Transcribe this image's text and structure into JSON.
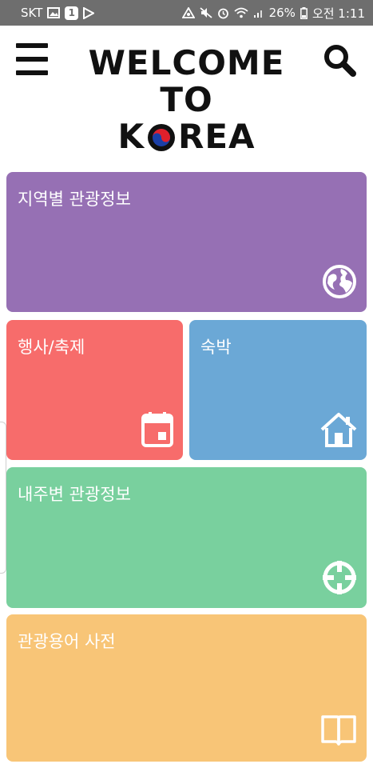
{
  "status_bar": {
    "carrier": "SKT",
    "badge": "1",
    "battery": "26%",
    "time": "오전 1:11"
  },
  "header": {
    "title_line1": "WELCOME",
    "title_line2": "TO",
    "title_k": "K",
    "title_rea": "REA"
  },
  "tiles": [
    {
      "label": "지역별 관광정보",
      "color": "#9670b4",
      "icon": "globe-icon"
    },
    {
      "label": "행사/축제",
      "color": "#f76c6b",
      "icon": "calendar-icon"
    },
    {
      "label": "숙박",
      "color": "#6ba8d6",
      "icon": "house-icon"
    },
    {
      "label": "내주변 관광정보",
      "color": "#79d09e",
      "icon": "crosshair-icon"
    },
    {
      "label": "관광용어 사전",
      "color": "#f8c577",
      "icon": "book-icon"
    }
  ]
}
